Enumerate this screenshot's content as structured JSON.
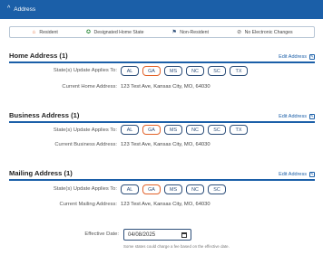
{
  "header": {
    "title": "Address"
  },
  "legend": [
    {
      "icon": "house-icon",
      "label": "Resident",
      "color": "#e1622a"
    },
    {
      "icon": "star-icon",
      "label": "Designated Home State",
      "color": "#2e8b3d"
    },
    {
      "icon": "flag-icon",
      "label": "Non-Resident",
      "color": "#2e4f7a"
    },
    {
      "icon": "no-change-icon",
      "label": "No Electronic Changes",
      "color": "#555555"
    }
  ],
  "sections": {
    "home": {
      "title": "Home Address (1)",
      "edit_label": "Edit Address",
      "states_label": "State(s) Update Applies To:",
      "states": [
        "AL",
        "GA",
        "MS",
        "NC",
        "SC",
        "TX"
      ],
      "address_label": "Current Home Address:",
      "address": "123 Test Ave, Kansas City, MO, 64030"
    },
    "business": {
      "title": "Business Address (1)",
      "edit_label": "Edit Address",
      "states_label": "State(s) Update Applies To:",
      "states": [
        "AL",
        "GA",
        "MS",
        "NC",
        "SC",
        "TX"
      ],
      "address_label": "Current Business Address:",
      "address": "123 Test Ave, Kansas City, MO, 64030"
    },
    "mailing": {
      "title": "Mailing Address (1)",
      "edit_label": "Edit Address",
      "states_label": "State(s) Update Applies To:",
      "states": [
        "AL",
        "GA",
        "MS",
        "NC",
        "SC"
      ],
      "address_label": "Current Mailing Address:",
      "address": "123 Test Ave, Kansas City, MO, 64030"
    }
  },
  "effective": {
    "label": "Effective Date:",
    "value": "04/08/2025",
    "note": "Some states could charge a fee based on the effective date."
  },
  "colors": {
    "primary": "#1b5fa8",
    "selected": "#e1622a"
  }
}
